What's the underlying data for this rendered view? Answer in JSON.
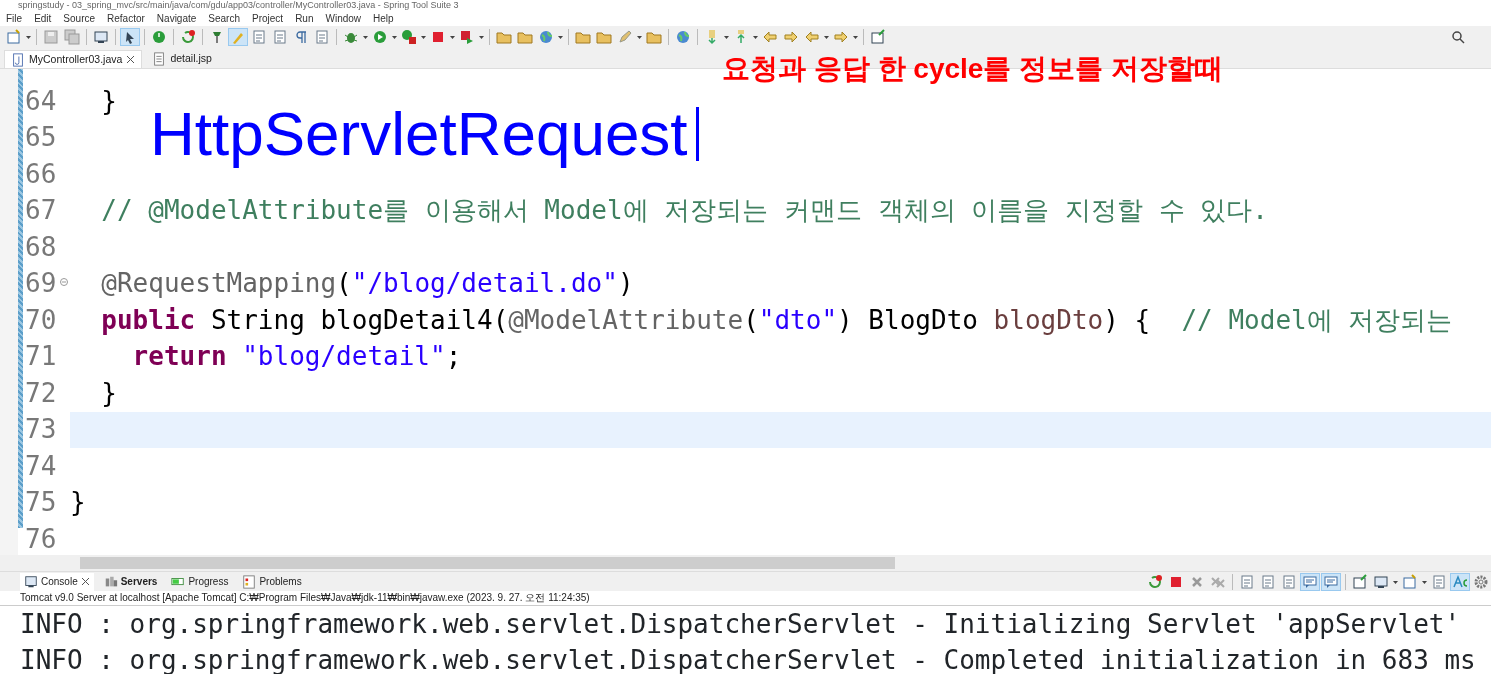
{
  "window": {
    "title": "springstudy - 03_spring_mvc/src/main/java/com/gdu/app03/controller/MyController03.java - Spring Tool Suite 3"
  },
  "menu": [
    "File",
    "Edit",
    "Source",
    "Refactor",
    "Navigate",
    "Search",
    "Project",
    "Run",
    "Window",
    "Help"
  ],
  "toolbar": [
    {
      "kind": "new",
      "selected": false,
      "dropdown": true
    },
    {
      "kind": "sep"
    },
    {
      "kind": "save",
      "selected": false
    },
    {
      "kind": "saveall",
      "selected": false
    },
    {
      "kind": "sep"
    },
    {
      "kind": "monitor",
      "selected": false
    },
    {
      "kind": "sep"
    },
    {
      "kind": "cursor",
      "selected": true
    },
    {
      "kind": "sep"
    },
    {
      "kind": "power",
      "selected": false
    },
    {
      "kind": "sep"
    },
    {
      "kind": "refresh",
      "selected": false
    },
    {
      "kind": "sep"
    },
    {
      "kind": "pin",
      "selected": false
    },
    {
      "kind": "brush",
      "selected": true
    },
    {
      "kind": "doc",
      "selected": false
    },
    {
      "kind": "doc",
      "selected": false
    },
    {
      "kind": "pilcrow",
      "selected": false
    },
    {
      "kind": "doc",
      "selected": false
    },
    {
      "kind": "sep"
    },
    {
      "kind": "bug",
      "selected": false,
      "dropdown": true
    },
    {
      "kind": "run",
      "selected": false,
      "dropdown": true
    },
    {
      "kind": "runext",
      "selected": false,
      "dropdown": true
    },
    {
      "kind": "stop",
      "selected": false,
      "dropdown": true
    },
    {
      "kind": "deploy",
      "selected": false,
      "dropdown": true
    },
    {
      "kind": "sep"
    },
    {
      "kind": "folder",
      "selected": false
    },
    {
      "kind": "folder",
      "selected": false
    },
    {
      "kind": "globe",
      "selected": false,
      "dropdown": true
    },
    {
      "kind": "sep"
    },
    {
      "kind": "folder",
      "selected": false
    },
    {
      "kind": "folder",
      "selected": false
    },
    {
      "kind": "pen",
      "selected": false,
      "dropdown": true
    },
    {
      "kind": "folder",
      "selected": false
    },
    {
      "kind": "sep"
    },
    {
      "kind": "globe",
      "selected": false
    },
    {
      "kind": "sep"
    },
    {
      "kind": "down",
      "selected": false,
      "dropdown": true
    },
    {
      "kind": "up",
      "selected": false,
      "dropdown": true
    },
    {
      "kind": "back",
      "selected": false
    },
    {
      "kind": "fwd",
      "selected": false
    },
    {
      "kind": "back",
      "selected": false,
      "dropdown": true
    },
    {
      "kind": "fwd",
      "selected": false,
      "dropdown": true
    },
    {
      "kind": "sep"
    },
    {
      "kind": "window",
      "selected": false
    }
  ],
  "editor_tabs": [
    {
      "label": "MyController03.java",
      "selected": true,
      "closable": true,
      "kind": "java"
    },
    {
      "label": "detail.jsp",
      "selected": false,
      "closable": false,
      "kind": "jsp"
    }
  ],
  "code": [
    {
      "number": "64",
      "folding": false,
      "current": false,
      "tokens": [
        {
          "kind": "plain",
          "text": "  }"
        }
      ]
    },
    {
      "number": "65",
      "folding": false,
      "current": false
    },
    {
      "number": "66",
      "folding": false,
      "current": false
    },
    {
      "number": "67",
      "folding": false,
      "current": false,
      "tokens": [
        {
          "kind": "comment",
          "text": "  // @ModelAttribute를 이용해서 Model에 저장되는 커맨드 객체의 이름을 지정할 수 있다."
        }
      ]
    },
    {
      "number": "68",
      "folding": false,
      "current": false
    },
    {
      "number": "69",
      "folding": true,
      "current": false,
      "tokens": [
        {
          "kind": "annotation",
          "text": "  @RequestMapping"
        },
        {
          "kind": "plain",
          "text": "("
        },
        {
          "kind": "string",
          "text": "\"/blog/detail.do\""
        },
        {
          "kind": "plain",
          "text": ")"
        }
      ]
    },
    {
      "number": "70",
      "folding": false,
      "current": false,
      "tokens": [
        {
          "kind": "keyword",
          "text": "  public"
        },
        {
          "kind": "plain",
          "text": " String blogDetail4("
        },
        {
          "kind": "annotation",
          "text": "@ModelAttribute"
        },
        {
          "kind": "plain",
          "text": "("
        },
        {
          "kind": "string",
          "text": "\"dto\""
        },
        {
          "kind": "plain",
          "text": ") BlogDto "
        },
        {
          "kind": "param",
          "text": "blogDto"
        },
        {
          "kind": "plain",
          "text": ") {  "
        },
        {
          "kind": "comment",
          "text": "// Model에 저장되는"
        }
      ]
    },
    {
      "number": "71",
      "folding": false,
      "current": false,
      "tokens": [
        {
          "kind": "keyword",
          "text": "    return "
        },
        {
          "kind": "string",
          "text": "\"blog/detail\""
        },
        {
          "kind": "plain",
          "text": ";"
        }
      ]
    },
    {
      "number": "72",
      "folding": false,
      "current": false,
      "tokens": [
        {
          "kind": "plain",
          "text": "  }"
        }
      ]
    },
    {
      "number": "73",
      "folding": false,
      "current": true
    },
    {
      "number": "74",
      "folding": false,
      "current": false
    },
    {
      "number": "75",
      "folding": false,
      "current": false,
      "tokens": [
        {
          "kind": "plain",
          "text": "}"
        }
      ]
    },
    {
      "number": "76",
      "folding": false,
      "current": false
    }
  ],
  "overlay_notes": [
    {
      "kind": "handwritten",
      "text": "요청과 응답 한 cycle를 정보를 저장할때"
    },
    {
      "kind": "typed",
      "text": "HttpServletRequest"
    }
  ],
  "console_tabs": [
    {
      "label": "Console",
      "selected": true,
      "closable": true,
      "kind": "console"
    },
    {
      "label": "Servers",
      "selected": false,
      "closable": false,
      "kind": "servers",
      "bold": true
    },
    {
      "label": "Progress",
      "selected": false,
      "closable": false,
      "kind": "progress"
    },
    {
      "label": "Problems",
      "selected": false,
      "closable": false,
      "kind": "problems"
    }
  ],
  "console_toolbar": [
    {
      "kind": "refresh",
      "selected": false
    },
    {
      "kind": "stop",
      "selected": false
    },
    {
      "kind": "x",
      "selected": false
    },
    {
      "kind": "xx",
      "selected": false
    },
    {
      "kind": "sep"
    },
    {
      "kind": "doc",
      "selected": false
    },
    {
      "kind": "doc",
      "selected": false
    },
    {
      "kind": "doc",
      "selected": false
    },
    {
      "kind": "chat",
      "selected": true
    },
    {
      "kind": "chat",
      "selected": true
    },
    {
      "kind": "sep"
    },
    {
      "kind": "window",
      "selected": false
    },
    {
      "kind": "monitor",
      "selected": false,
      "dropdown": true
    },
    {
      "kind": "new",
      "selected": false,
      "dropdown": true
    },
    {
      "kind": "doc",
      "selected": false
    },
    {
      "kind": "ac",
      "selected": true
    },
    {
      "kind": "gear",
      "selected": false
    }
  ],
  "console_description": "Tomcat v9.0 Server at localhost [Apache Tomcat] C:₩Program Files₩Java₩jdk-11₩bin₩javaw.exe  (2023. 9. 27. 오전 11:24:35)",
  "console_lines": [
    "INFO : org.springframework.web.servlet.DispatcherServlet - Initializing Servlet 'appServlet'",
    "INFO : org.springframework.web.servlet.DispatcherServlet - Completed initialization in 683 ms"
  ]
}
